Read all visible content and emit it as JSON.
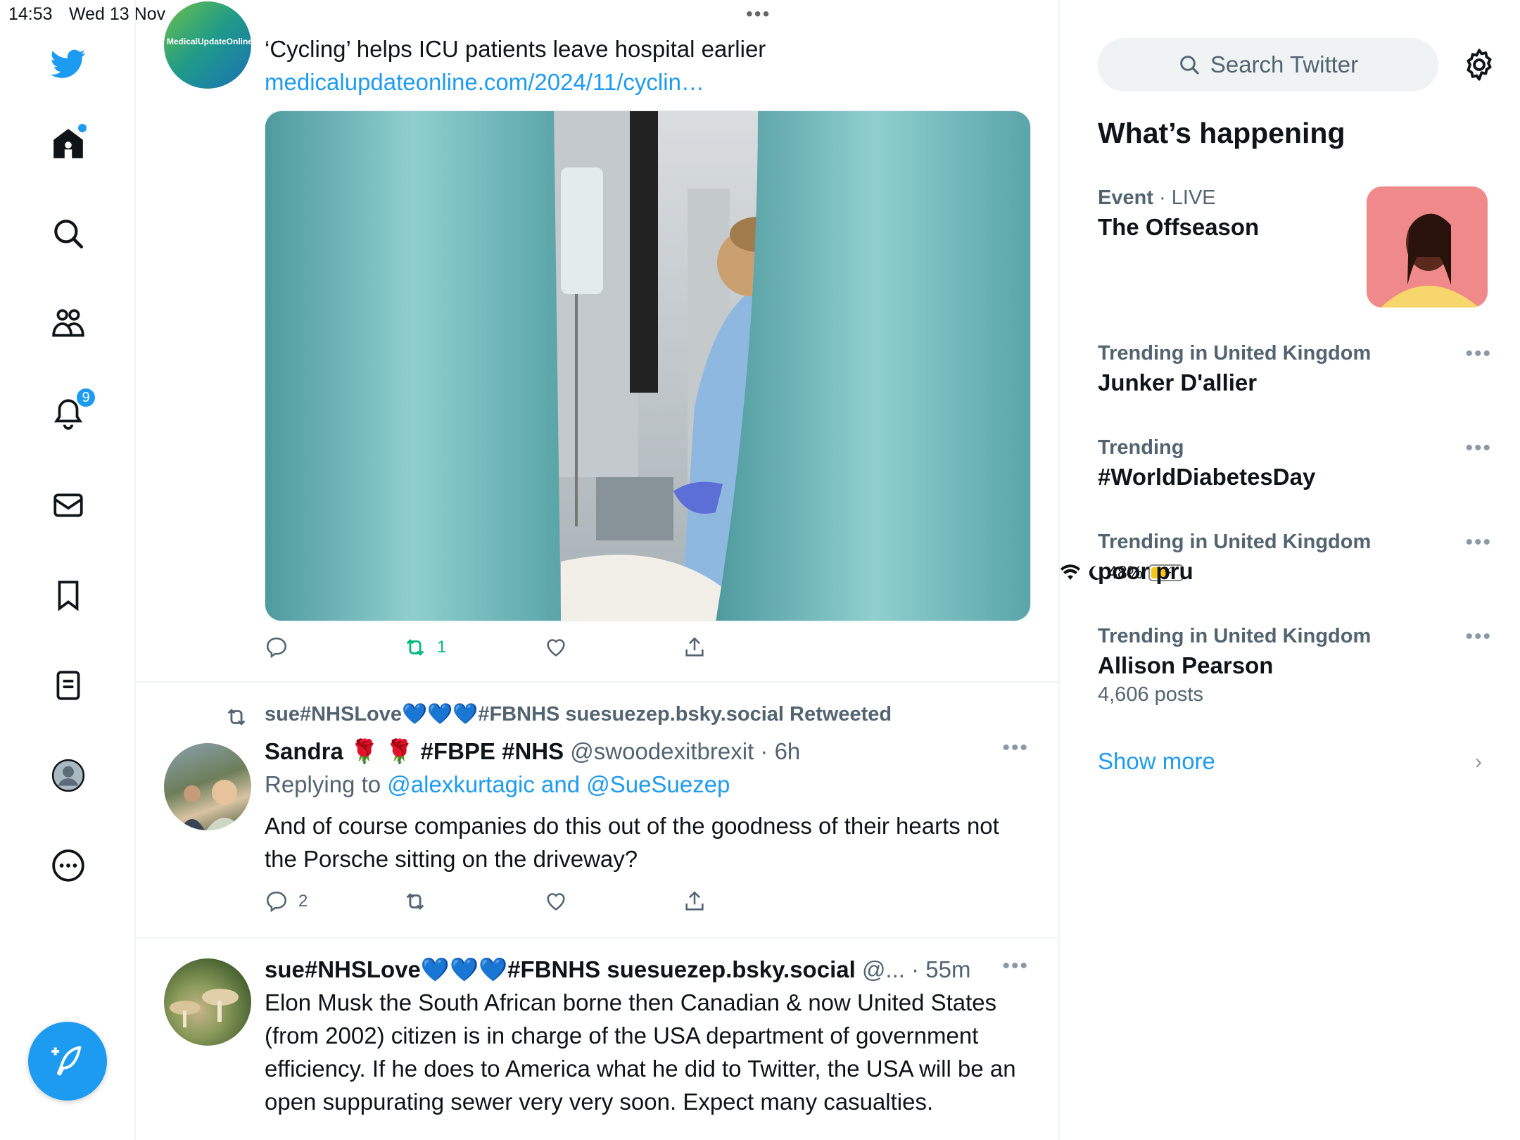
{
  "status": {
    "time": "14:53",
    "date": "Wed 13 Nov",
    "battery": "48%"
  },
  "sidebar": {
    "notifications_badge": "9"
  },
  "tweets": [
    {
      "avatar_text": "MedicalUpdateOnline",
      "text": "‘Cycling’ helps ICU patients leave hospital earlier",
      "link": "medicalupdateonline.com/2024/11/cyclin…",
      "retweets": "1"
    },
    {
      "retweeted_by": "sue#NHSLove💙💙💙#FBNHS suesuezep.bsky.social Retweeted",
      "author": "Sandra 🌹 🌹 #FBPE #NHS",
      "handle": "@swoodexitbrexit",
      "time": "· 6h",
      "replying_label": "Replying to",
      "replying_to": "@alexkurtagic and @SueSuezep",
      "text": "And of course companies do this out of the goodness of their hearts not the Porsche sitting on the driveway?",
      "replies": "2"
    },
    {
      "author": "sue#NHSLove💙💙💙#FBNHS suesuezep.bsky.social",
      "handle": "@...",
      "time": "· 55m",
      "text": "Elon Musk the South African borne then Canadian & now  United States (from 2002) citizen is in charge of the USA department of government efficiency. If he does to America what he did to Twitter, the USA will be an open suppurating sewer very very soon. Expect many casualties."
    }
  ],
  "search": {
    "placeholder": "Search Twitter"
  },
  "whats_happening": {
    "title": "What’s happening",
    "event": {
      "category": "Event",
      "status": "· LIVE",
      "name": "The Offseason"
    },
    "trends": [
      {
        "context": "Trending in United Kingdom",
        "name": "Junker D'allier",
        "posts": ""
      },
      {
        "context": "Trending",
        "name": "#WorldDiabetesDay",
        "posts": ""
      },
      {
        "context": "Trending in United Kingdom",
        "name": "poor pru",
        "posts": ""
      },
      {
        "context": "Trending in United Kingdom",
        "name": "Allison Pearson",
        "posts": "4,606 posts"
      }
    ],
    "show_more": "Show more"
  }
}
